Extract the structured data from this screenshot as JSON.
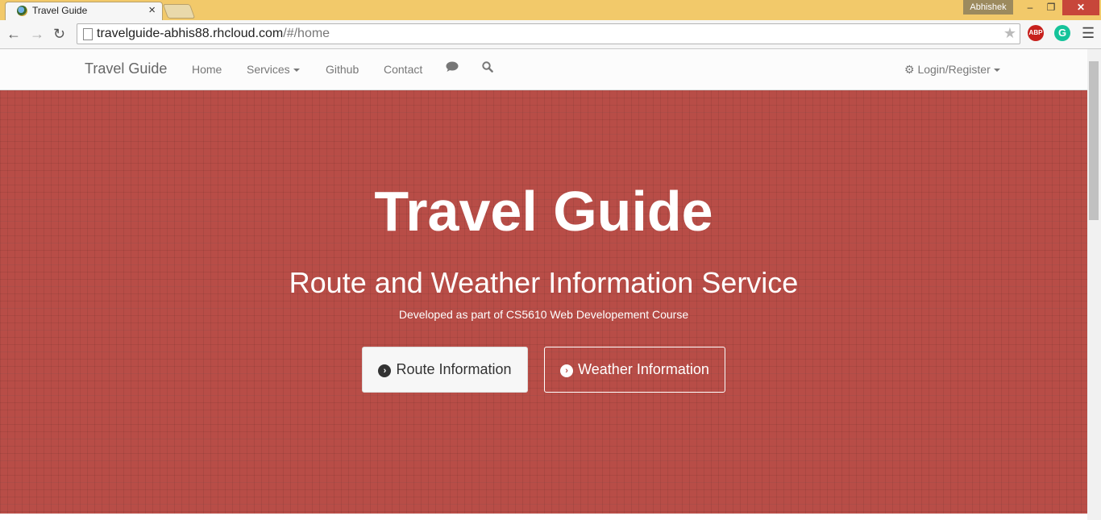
{
  "browser": {
    "tab_title": "Travel Guide",
    "tab_close": "×",
    "profile_name": "Abhishek",
    "url_host": "travelguide-abhis88.rhcloud.com",
    "url_path": "/#/home",
    "abp_label": "ABP",
    "grammarly_label": "G",
    "window_min": "–",
    "window_max": "❐",
    "window_close": "✕"
  },
  "navbar": {
    "brand": "Travel Guide",
    "links": [
      "Home",
      "Services",
      "Github",
      "Contact"
    ],
    "login_label": "Login/Register"
  },
  "hero": {
    "title": "Travel Guide",
    "subtitle": "Route and Weather Information Service",
    "note": "Developed as part of CS5610 Web Developement Course",
    "buttons": [
      "Route Information",
      "Weather Information"
    ]
  },
  "colors": {
    "hero_background": "#b84d47",
    "chrome_frame": "#f2c96a"
  },
  "icons": [
    "chrome-favicon-icon",
    "back-arrow-icon",
    "forward-arrow-icon",
    "reload-icon",
    "page-icon",
    "bookmark-star-icon",
    "adblock-icon",
    "grammarly-icon",
    "chrome-menu-icon",
    "chat-comment-icon",
    "search-icon",
    "gear-icon",
    "chevron-circle-right-icon"
  ]
}
